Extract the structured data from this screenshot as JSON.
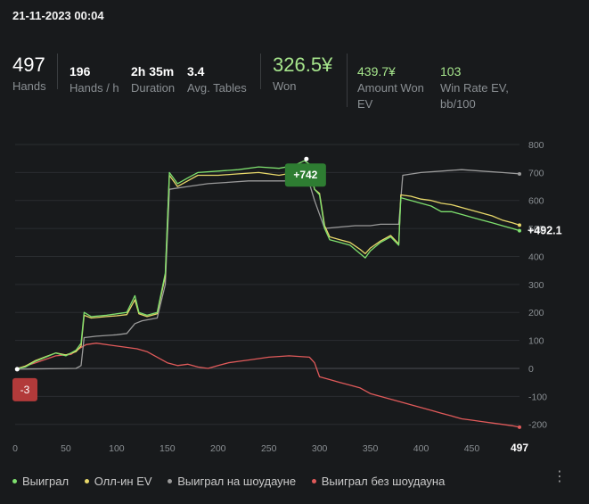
{
  "session": {
    "date": "21-11-2023 00:04"
  },
  "stats": [
    {
      "key": "hands",
      "value": "497",
      "label": "Hands"
    },
    {
      "key": "hands_per_hour",
      "value": "196",
      "label": "Hands / h"
    },
    {
      "key": "duration",
      "value": "2h 35m",
      "label": "Duration"
    },
    {
      "key": "avg_tables",
      "value": "3.4",
      "label": "Avg. Tables"
    },
    {
      "key": "won",
      "value": "326.5¥",
      "label": "Won"
    },
    {
      "key": "amount_won_ev",
      "value": "439.7¥",
      "label": "Amount Won EV"
    },
    {
      "key": "win_rate_ev",
      "value": "103",
      "label": "Win Rate EV, bb/100"
    }
  ],
  "chart_data": {
    "type": "line",
    "xlim": [
      0,
      497
    ],
    "ylim": [
      -220,
      800
    ],
    "x_ticks": [
      0,
      50,
      100,
      150,
      200,
      250,
      300,
      350,
      400,
      450
    ],
    "x_end_label": "497",
    "y_ticks": [
      800,
      700,
      600,
      500,
      400,
      300,
      200,
      100,
      0,
      -100,
      -200
    ],
    "grid": true,
    "legend_position": "bottom",
    "annotations": {
      "max": {
        "x": 287,
        "y": 742,
        "label": "+742"
      },
      "min": {
        "x": 2,
        "y": -3,
        "label": "-3"
      },
      "end": {
        "label": "+492.1"
      }
    },
    "series": [
      {
        "name": "Выиграл",
        "color": "#7ee06e",
        "points": [
          [
            0,
            -3
          ],
          [
            10,
            5
          ],
          [
            20,
            25
          ],
          [
            30,
            40
          ],
          [
            40,
            55
          ],
          [
            50,
            45
          ],
          [
            60,
            65
          ],
          [
            65,
            90
          ],
          [
            68,
            200
          ],
          [
            75,
            185
          ],
          [
            90,
            190
          ],
          [
            100,
            195
          ],
          [
            110,
            200
          ],
          [
            118,
            260
          ],
          [
            122,
            200
          ],
          [
            130,
            190
          ],
          [
            140,
            200
          ],
          [
            148,
            340
          ],
          [
            152,
            700
          ],
          [
            160,
            660
          ],
          [
            170,
            680
          ],
          [
            180,
            700
          ],
          [
            200,
            705
          ],
          [
            220,
            710
          ],
          [
            240,
            720
          ],
          [
            260,
            715
          ],
          [
            275,
            725
          ],
          [
            285,
            742
          ],
          [
            290,
            730
          ],
          [
            295,
            640
          ],
          [
            300,
            620
          ],
          [
            305,
            500
          ],
          [
            310,
            460
          ],
          [
            320,
            450
          ],
          [
            330,
            440
          ],
          [
            340,
            410
          ],
          [
            345,
            395
          ],
          [
            350,
            420
          ],
          [
            360,
            450
          ],
          [
            370,
            470
          ],
          [
            378,
            440
          ],
          [
            380,
            610
          ],
          [
            390,
            600
          ],
          [
            400,
            590
          ],
          [
            410,
            580
          ],
          [
            420,
            560
          ],
          [
            430,
            560
          ],
          [
            440,
            550
          ],
          [
            450,
            540
          ],
          [
            460,
            530
          ],
          [
            470,
            520
          ],
          [
            480,
            510
          ],
          [
            490,
            500
          ],
          [
            497,
            492
          ]
        ]
      },
      {
        "name": "Олл-ин EV",
        "color": "#e8d86a",
        "points": [
          [
            0,
            -3
          ],
          [
            10,
            8
          ],
          [
            20,
            28
          ],
          [
            30,
            42
          ],
          [
            40,
            55
          ],
          [
            50,
            48
          ],
          [
            60,
            60
          ],
          [
            65,
            80
          ],
          [
            68,
            190
          ],
          [
            75,
            180
          ],
          [
            90,
            185
          ],
          [
            100,
            188
          ],
          [
            110,
            192
          ],
          [
            118,
            245
          ],
          [
            122,
            195
          ],
          [
            130,
            185
          ],
          [
            140,
            195
          ],
          [
            148,
            330
          ],
          [
            152,
            690
          ],
          [
            160,
            650
          ],
          [
            170,
            670
          ],
          [
            180,
            690
          ],
          [
            200,
            690
          ],
          [
            220,
            695
          ],
          [
            240,
            700
          ],
          [
            260,
            690
          ],
          [
            275,
            700
          ],
          [
            285,
            710
          ],
          [
            290,
            705
          ],
          [
            295,
            640
          ],
          [
            300,
            625
          ],
          [
            305,
            510
          ],
          [
            310,
            470
          ],
          [
            320,
            460
          ],
          [
            330,
            450
          ],
          [
            340,
            425
          ],
          [
            345,
            410
          ],
          [
            350,
            430
          ],
          [
            360,
            455
          ],
          [
            370,
            475
          ],
          [
            378,
            445
          ],
          [
            380,
            620
          ],
          [
            390,
            615
          ],
          [
            400,
            605
          ],
          [
            410,
            600
          ],
          [
            420,
            590
          ],
          [
            430,
            585
          ],
          [
            440,
            575
          ],
          [
            450,
            565
          ],
          [
            460,
            555
          ],
          [
            470,
            545
          ],
          [
            480,
            530
          ],
          [
            490,
            520
          ],
          [
            497,
            512
          ]
        ]
      },
      {
        "name": "Выиграл на шоудауне",
        "color": "#9a9a9a",
        "points": [
          [
            0,
            -3
          ],
          [
            60,
            0
          ],
          [
            65,
            10
          ],
          [
            68,
            110
          ],
          [
            80,
            115
          ],
          [
            100,
            120
          ],
          [
            110,
            125
          ],
          [
            118,
            160
          ],
          [
            125,
            170
          ],
          [
            140,
            180
          ],
          [
            148,
            300
          ],
          [
            152,
            640
          ],
          [
            170,
            650
          ],
          [
            190,
            660
          ],
          [
            210,
            665
          ],
          [
            230,
            670
          ],
          [
            250,
            670
          ],
          [
            270,
            670
          ],
          [
            280,
            670
          ],
          [
            290,
            660
          ],
          [
            295,
            600
          ],
          [
            305,
            500
          ],
          [
            320,
            505
          ],
          [
            335,
            510
          ],
          [
            350,
            510
          ],
          [
            360,
            515
          ],
          [
            378,
            515
          ],
          [
            382,
            690
          ],
          [
            400,
            700
          ],
          [
            420,
            705
          ],
          [
            440,
            710
          ],
          [
            460,
            705
          ],
          [
            480,
            700
          ],
          [
            497,
            695
          ]
        ]
      },
      {
        "name": "Выиграл без шоудауна",
        "color": "#e05a5a",
        "points": [
          [
            0,
            -3
          ],
          [
            20,
            20
          ],
          [
            40,
            45
          ],
          [
            55,
            50
          ],
          [
            65,
            75
          ],
          [
            70,
            85
          ],
          [
            80,
            90
          ],
          [
            100,
            80
          ],
          [
            120,
            70
          ],
          [
            130,
            60
          ],
          [
            140,
            40
          ],
          [
            150,
            20
          ],
          [
            160,
            10
          ],
          [
            170,
            15
          ],
          [
            180,
            5
          ],
          [
            190,
            0
          ],
          [
            200,
            10
          ],
          [
            210,
            20
          ],
          [
            220,
            25
          ],
          [
            230,
            30
          ],
          [
            250,
            40
          ],
          [
            270,
            45
          ],
          [
            290,
            40
          ],
          [
            295,
            20
          ],
          [
            300,
            -30
          ],
          [
            310,
            -40
          ],
          [
            320,
            -50
          ],
          [
            330,
            -60
          ],
          [
            340,
            -70
          ],
          [
            350,
            -90
          ],
          [
            360,
            -100
          ],
          [
            370,
            -110
          ],
          [
            380,
            -120
          ],
          [
            390,
            -130
          ],
          [
            400,
            -140
          ],
          [
            410,
            -150
          ],
          [
            420,
            -160
          ],
          [
            430,
            -170
          ],
          [
            440,
            -180
          ],
          [
            450,
            -185
          ],
          [
            460,
            -190
          ],
          [
            470,
            -195
          ],
          [
            480,
            -200
          ],
          [
            490,
            -205
          ],
          [
            497,
            -210
          ]
        ]
      }
    ]
  },
  "legend": [
    {
      "label": "Выиграл",
      "color": "#7ee06e"
    },
    {
      "label": "Олл-ин EV",
      "color": "#e8d86a"
    },
    {
      "label": "Выиграл на шоудауне",
      "color": "#9a9a9a"
    },
    {
      "label": "Выиграл без шоудауна",
      "color": "#e05a5a"
    }
  ],
  "menu": {
    "icon": "more-vertical-icon",
    "glyph": "⋮"
  }
}
